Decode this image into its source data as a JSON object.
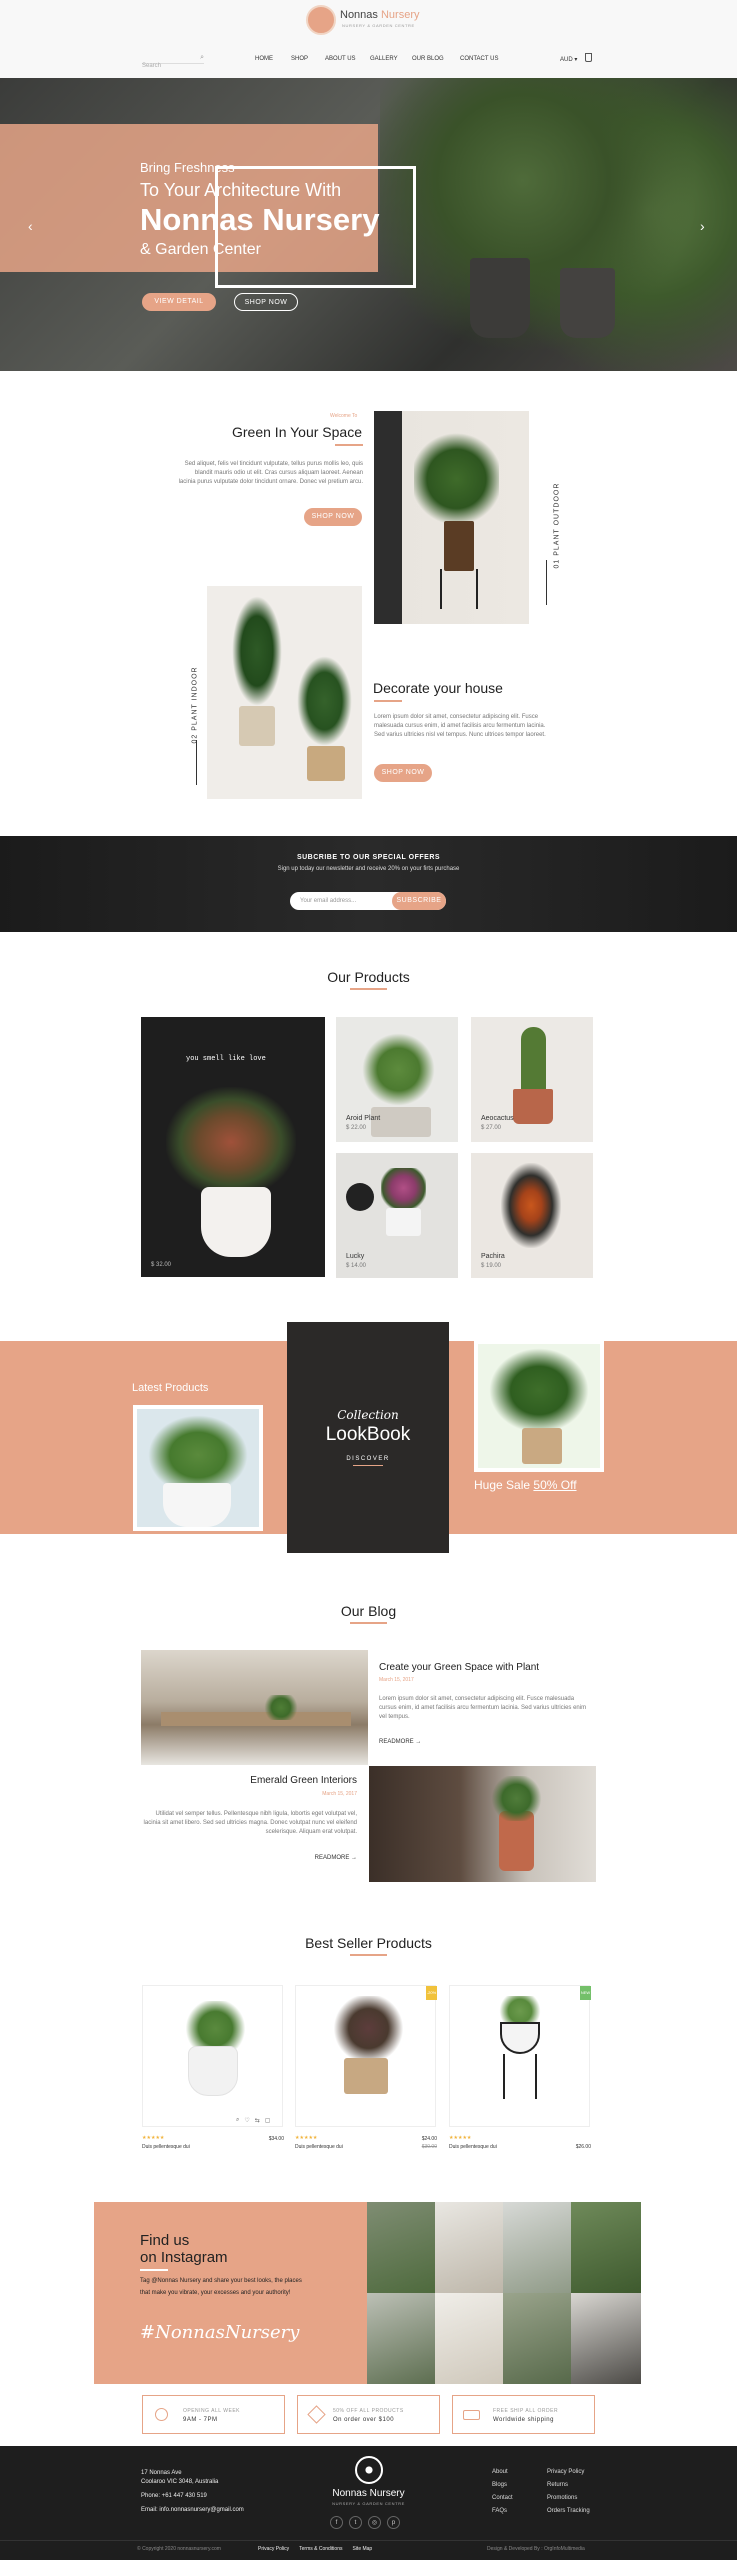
{
  "header": {
    "brand": "Nonnas",
    "brand_accent": "Nursery",
    "tagline": "NURSERY & GARDEN CENTRE",
    "search_placeholder": "Search",
    "nav": [
      "HOME",
      "SHOP",
      "ABOUT US",
      "GALLERY",
      "OUR BLOG",
      "CONTACT US"
    ],
    "currency": "AUD"
  },
  "hero": {
    "line1": "Bring Freshness",
    "line2": "To Your Architecture With",
    "line3": "Nonnas Nursery",
    "line4": "& Garden Center",
    "btn1": "VIEW DETAIL",
    "btn2": "SHOP NOW"
  },
  "feature1": {
    "kicker": "Welcome To",
    "title": "Green In Your Space",
    "text": "Sed aliquet, felis vel tincidunt vulputate, tellus purus mollis leo, quis blandit mauris odio ut elit. Cras cursus aliquam laoreet. Aenean lacinia purus vulputate dolor tincidunt ornare. Donec vel pretium arcu.",
    "button": "SHOP NOW",
    "vertical": "01 PLANT OUTDOOR"
  },
  "feature2": {
    "title": "Decorate your house",
    "text": "Lorem ipsum dolor sit amet, consectetur adipiscing elit. Fusce malesuada cursus enim, id amet facilisis arcu fermentum lacinia. Sed varius ultricies nisl vel tempus. Nunc ultrices tempor laoreet.",
    "button": "SHOP NOW",
    "vertical": "02 PLANT INDOOR"
  },
  "newsletter": {
    "title": "SUBCRIBE TO OUR SPECIAL OFFERS",
    "subtitle": "Sign up today our newsletter and receive 20% on your firts purchase",
    "placeholder": "Your email address...",
    "button": "SUBSCRIBE"
  },
  "products": {
    "title": "Our Products",
    "big_tag": "you smell like love",
    "big_price": "$ 32.00",
    "items": [
      {
        "name": "Aroid Plant",
        "price": "$ 22.00"
      },
      {
        "name": "Aeocactus",
        "price": "$ 27.00"
      },
      {
        "name": "Lucky",
        "price": "$ 14.00"
      },
      {
        "name": "Pachira",
        "price": "$ 19.00"
      }
    ]
  },
  "lookbook": {
    "latest": "Latest Products",
    "script": "Collection",
    "title": "LookBook",
    "discover": "DISCOVER",
    "sale_text": "Huge Sale",
    "sale_highlight": "50% Off"
  },
  "blog": {
    "title": "Our Blog",
    "post1": {
      "title": "Create your Green Space with Plant",
      "date": "March 15, 2017",
      "text": "Lorem ipsum dolor sit amet, consectetur adipiscing elit. Fusce malesuada cursus enim, id amet facilisis arcu fermentum lacinia. Sed varius ultricies enim vel tempus.",
      "more": "READMORE"
    },
    "post2": {
      "title": "Emerald Green Interiors",
      "date": "March 15, 2017",
      "text": "Utilidat vel semper tellus. Pellentesque nibh ligula, lobortis eget volutpat vel, lacinia sit amet libero. Sed sed ultricies magna. Donec volutpat nunc vel eleifend scelerisque. Aliquam erat volutpat.",
      "more": "READMORE"
    }
  },
  "bestseller": {
    "title": "Best Seller Products",
    "items": [
      {
        "stars": "★★★★★",
        "name": "Duis pellentesque dui",
        "price": "$34.00",
        "badge": ""
      },
      {
        "stars": "★★★★★",
        "name": "Duis pellentesque dui",
        "price": "$24.00",
        "old": "$30.00",
        "badge": "-20%"
      },
      {
        "stars": "★★★★★",
        "name": "Duis pellentesque dui",
        "price": "$26.00",
        "badge": "NEW"
      }
    ]
  },
  "instagram": {
    "title1": "Find us",
    "title2": "on Instagram",
    "text": "Tag @Nonnas Nursery and share your best looks, the places that make you vibrate, your excesses and your authority!",
    "hashtag": "#NonnasNursery"
  },
  "features_bar": [
    {
      "title": "OPENING ALL WEEK",
      "sub": "9AM - 7PM"
    },
    {
      "title": "50% OFF ALL PRODUCTS",
      "sub": "On order over $100"
    },
    {
      "title": "FREE SHIP ALL ORDER",
      "sub": "Worldwide shipping"
    }
  ],
  "footer": {
    "address1": "17 Nonnas Ave",
    "address2": "Coolaroo VIC 3048, Australia",
    "phone": "Phone: +61 447 430 519",
    "email": "Email: info.nonnasnursery@gmail.com",
    "col1": [
      "About",
      "Blogs",
      "Contact",
      "FAQs"
    ],
    "col2": [
      "Privacy Policy",
      "Returns",
      "Promotions",
      "Orders Tracking"
    ],
    "copyright": "© Copyright 2020 nonnasnursery.com",
    "bottom_links": [
      "Privacy Policy",
      "Terms & Conditions",
      "Site Map"
    ],
    "credit": "Design & Developed By : OrgInfoMultimedia"
  },
  "colors": {
    "accent": "#e6a487",
    "dark": "#1e1e1e"
  }
}
